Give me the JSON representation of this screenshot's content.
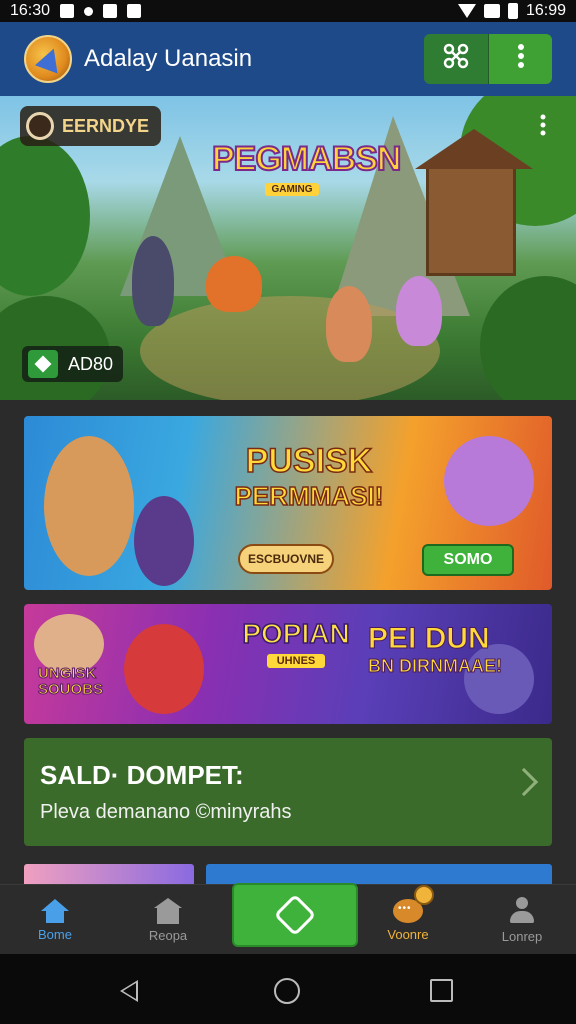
{
  "status_bar": {
    "time_left": "16:30",
    "time_right": "16:99"
  },
  "app_bar": {
    "title": "Adalay Uanasin",
    "logo_icon": "app-logo-icon",
    "action_icon": "share-hub-icon",
    "menu_icon": "more-vertical-icon"
  },
  "hero": {
    "badge_label": "EERNDYE",
    "logo_title": "PEGMABSN",
    "logo_subtitle": "GAMING",
    "price_label": "AD80",
    "menu_icon": "more-vertical-icon"
  },
  "banner1": {
    "title_line1": "PUSISK",
    "title_line2": "PERMMASI!",
    "pill_label": "ESCBUOVNE",
    "cta_label": "SOMO"
  },
  "banner2": {
    "left_text_line1": "UNGISK",
    "left_text_line2": "SOUOBS",
    "center_logo": "POPIAN",
    "center_sub": "UHNES",
    "right_line1": "PEI DUN",
    "right_line2": "BN DIRNMAAE!"
  },
  "wallet": {
    "title": "SALD· DOMPET:",
    "subtitle": "Pleva demanano ©minyrahs"
  },
  "bottom_nav": {
    "items": [
      {
        "label": "Bome",
        "icon": "home-icon"
      },
      {
        "label": "Reopa",
        "icon": "shop-icon"
      },
      {
        "label": "",
        "icon": "hexagon-icon"
      },
      {
        "label": "Voonre",
        "icon": "chat-coin-icon"
      },
      {
        "label": "Lonrep",
        "icon": "user-icon"
      }
    ]
  },
  "colors": {
    "app_bar": "#1f4a8a",
    "accent_green": "#3fb23c",
    "wallet_green": "#3a6b2a",
    "nav_active": "#4aa0e8",
    "nav_voucher": "#f0b43a"
  }
}
